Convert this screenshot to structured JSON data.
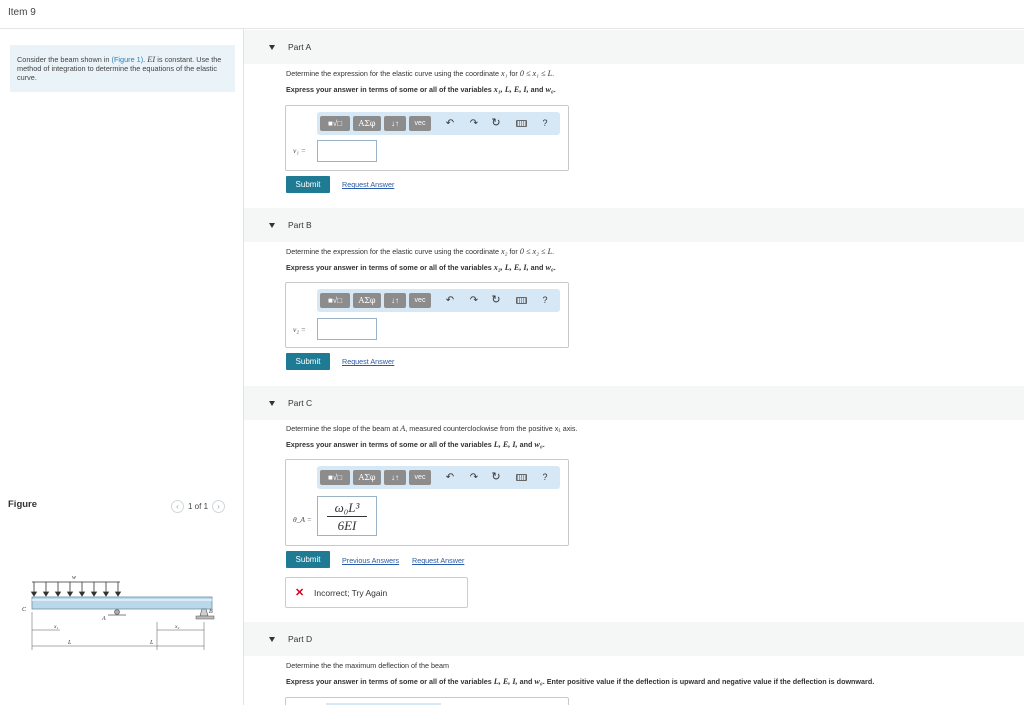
{
  "item": {
    "title": "Item 9"
  },
  "problem": {
    "intro": "Consider the beam shown in ",
    "figure_link": "(Figure 1)",
    "ei": "EI",
    "rest": " is constant. Use the method of integration to determine the equations of the elastic curve."
  },
  "figure": {
    "label": "Figure",
    "page": "1 of 1",
    "prev_icon": "chevron-left",
    "next_icon": "chevron-right",
    "labels": {
      "w": "w",
      "C": "C",
      "A": "A",
      "B": "B",
      "x1": "x₁",
      "x2": "x₂",
      "L1": "L",
      "L2": "L"
    }
  },
  "toolbar": {
    "templates": "■√□",
    "greek": "ΑΣφ",
    "arrows": "↓↑",
    "vec": "vec",
    "undo_icon": "undo-arrow",
    "redo_icon": "redo-arrow",
    "reset_icon": "reset-circle",
    "keyboard_icon": "keyboard",
    "help": "?"
  },
  "parts": {
    "a": {
      "label": "Part A",
      "q_pre": "Determine the expression for the elastic curve using the coordinate ",
      "q_var": "x₁",
      "q_mid": " for ",
      "q_range": "0 ≤ x₁ ≤ L",
      "q_end": ".",
      "express_pre": "Express your answer in terms of some or all of the variables ",
      "express_vars": "x₁, L, E, I,",
      "express_and": " and ",
      "express_w": "w₀",
      "express_end": ".",
      "var_label": "v₁ =",
      "input_value": "",
      "submit": "Submit",
      "request": "Request Answer"
    },
    "b": {
      "label": "Part B",
      "q_pre": "Determine the expression for the elastic curve using the coordinate ",
      "q_var": "x₂",
      "q_mid": " for ",
      "q_range": "0 ≤ x₂ ≤ L",
      "q_end": ".",
      "express_pre": "Express your answer in terms of some or all of the variables ",
      "express_vars": "x₂, L, E, I,",
      "express_and": " and ",
      "express_w": "w₀",
      "express_end": ".",
      "var_label": "v₂ =",
      "input_value": "",
      "submit": "Submit",
      "request": "Request Answer"
    },
    "c": {
      "label": "Part C",
      "q_pre": "Determine the slope of the beam at ",
      "q_var": "A",
      "q_end": ", measured counterclockwise from the positive x₁ axis.",
      "express_pre": "Express your answer in terms of some or all of the variables ",
      "express_vars": "L, E, I,",
      "express_and": " and ",
      "express_w": "w₀",
      "express_end": ".",
      "var_label": "θ_A =",
      "answer_num": "ω₀L³",
      "answer_den": "6EI",
      "submit": "Submit",
      "previous": "Previous Answers",
      "request": "Request Answer",
      "feedback": "Incorrect; Try Again"
    },
    "d": {
      "label": "Part D",
      "q": "Determine the the maximum deflection of the beam",
      "express_pre": "Express your answer in terms of some or all of the variables ",
      "express_vars": "L, E, I,",
      "express_and": " and ",
      "express_w": "w₀",
      "express_end": ". Enter positive value if the deflection is upward and negative value if the deflection is downward."
    }
  }
}
